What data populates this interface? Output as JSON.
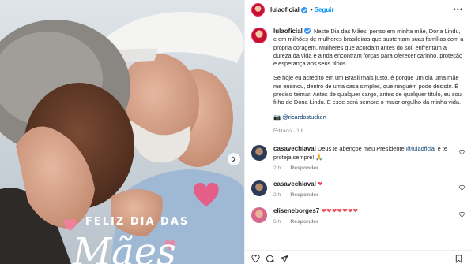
{
  "media": {
    "caption_line1": "FELIZ DIA DAS",
    "caption_line2": "Mães"
  },
  "header": {
    "username": "lulaoficial",
    "separator": "•",
    "follow_label": "Seguir",
    "more_label": "•••"
  },
  "post": {
    "username": "lulaoficial",
    "paragraph1": "Neste Dia das Mães, penso em minha mãe, Dona Lindu, e em milhões de mulheres brasileiras que sustentam suas famílias com a própria coragem. Mulheres que acordam antes do sol, enfrentam a dureza da vida e ainda encontram forças para oferecer carinho, proteção e esperança aos seus filhos.",
    "paragraph2": "Se hoje eu acredito em um Brasil mais justo, é porque um dia uma mãe me ensinou, dentro de uma casa simples, que ninguém pode desistir. É preciso teimar. Antes de qualquer cargo, antes de qualquer título, eu sou filho de Dona Lindu. E esse será sempre o maior orgulho da minha vida.",
    "credit": "📷 @ricardostuckert",
    "edited": "Editado · 1 h"
  },
  "comments": [
    {
      "user": "casavechiaval",
      "text_before": "Deus te abençoe meu Presidente ",
      "mention": "@lulaoficial",
      "text_after": " e te proteja sempre! 🙏",
      "time": "2 h",
      "reply": "Responder"
    },
    {
      "user": "casavechiaval",
      "text_before": "",
      "mention": "",
      "text_after": "❤",
      "time": "2 h",
      "reply": "Responder"
    },
    {
      "user": "eliseneborges7",
      "text_before": "",
      "mention": "",
      "text_after": "❤❤❤❤❤❤❤",
      "time": "6 h",
      "reply": "Responder"
    }
  ],
  "icons": {
    "like": "heart-icon",
    "comment": "comment-icon",
    "share": "share-icon",
    "save": "bookmark-icon",
    "next": "chevron-right-icon"
  },
  "colors": {
    "link": "#0095f6",
    "mention": "#00376b",
    "heart": "#ed4956",
    "verified": "#3897f0"
  }
}
